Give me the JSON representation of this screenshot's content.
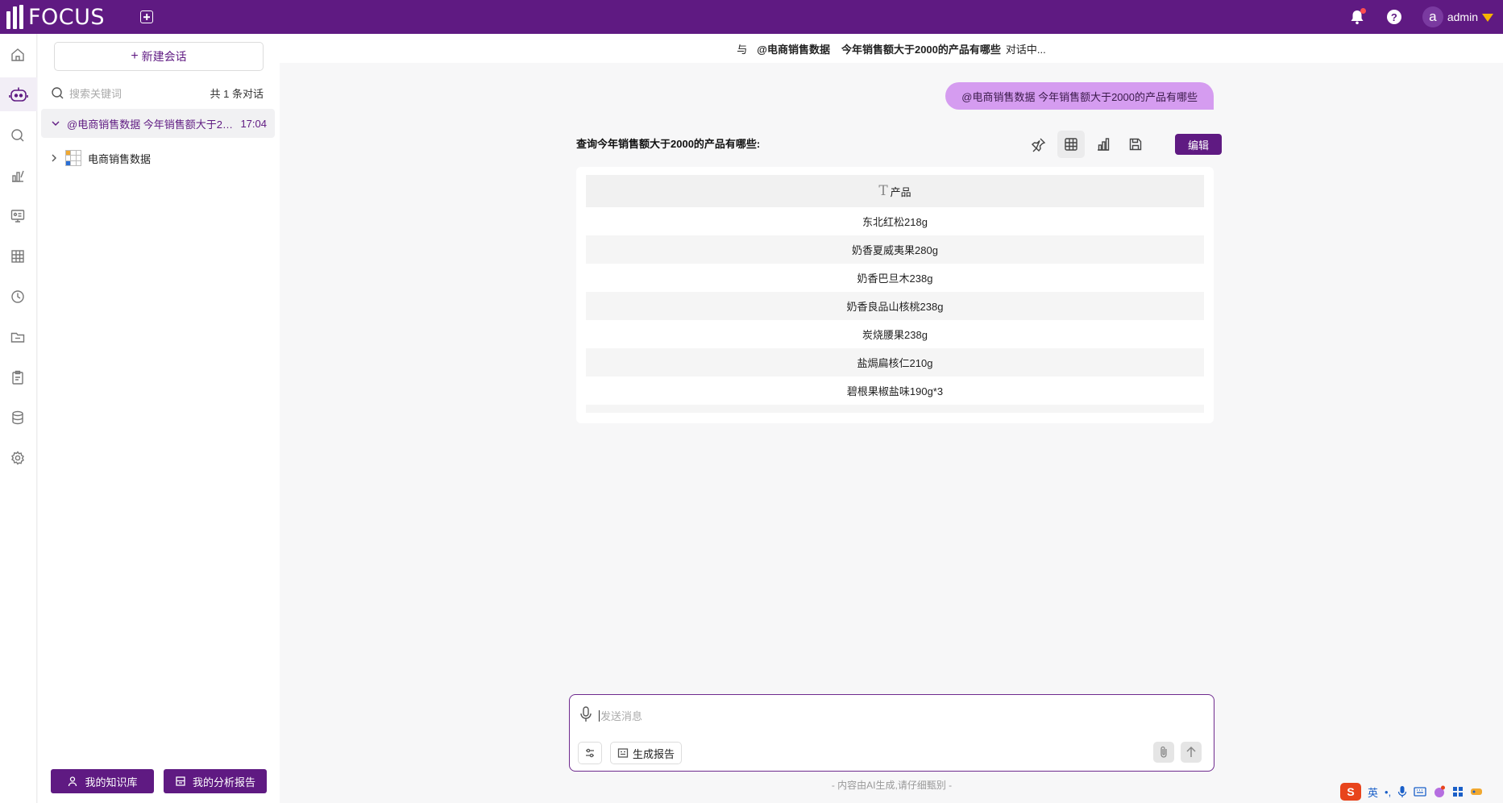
{
  "app": {
    "logo_text": "FOCUS",
    "user_initial": "a",
    "user_name": "admin"
  },
  "sidebar": {
    "new_chat_label": "新建会话",
    "search_placeholder": "搜索关键词",
    "count_prefix": "共",
    "count_value": "1",
    "count_suffix": "条对话",
    "conversation": {
      "title": "@电商销售数据 今年销售额大于2000的产品有哪些",
      "time": "17:04"
    },
    "dataset_name": "电商销售数据",
    "knowledge_button": "我的知识库",
    "report_button": "我的分析报告"
  },
  "main": {
    "header": {
      "prefix": "与",
      "dataset": "@电商销售数据",
      "question": "今年销售额大于2000的产品有哪些",
      "suffix": "对话中..."
    },
    "user_message": "@电商销售数据 今年销售额大于2000的产品有哪些",
    "answer_title": "查询今年销售额大于2000的产品有哪些:",
    "edit_label": "编辑",
    "table": {
      "column": "产品",
      "rows": [
        "东北红松218g",
        "奶香夏威夷果280g",
        "奶香巴旦木238g",
        "奶香良品山核桃238g",
        "炭烧腰果238g",
        "盐焗扁核仁210g",
        "碧根果椒盐味190g*3"
      ]
    },
    "input": {
      "placeholder": "发送消息",
      "generate_report": "生成报告"
    },
    "disclaimer": "- 内容由AI生成,请仔细甄别 -"
  },
  "ime": {
    "logo": "S",
    "lang": "英"
  },
  "colors": {
    "brand": "#5f1a82",
    "bubble": "#d59cf0"
  }
}
